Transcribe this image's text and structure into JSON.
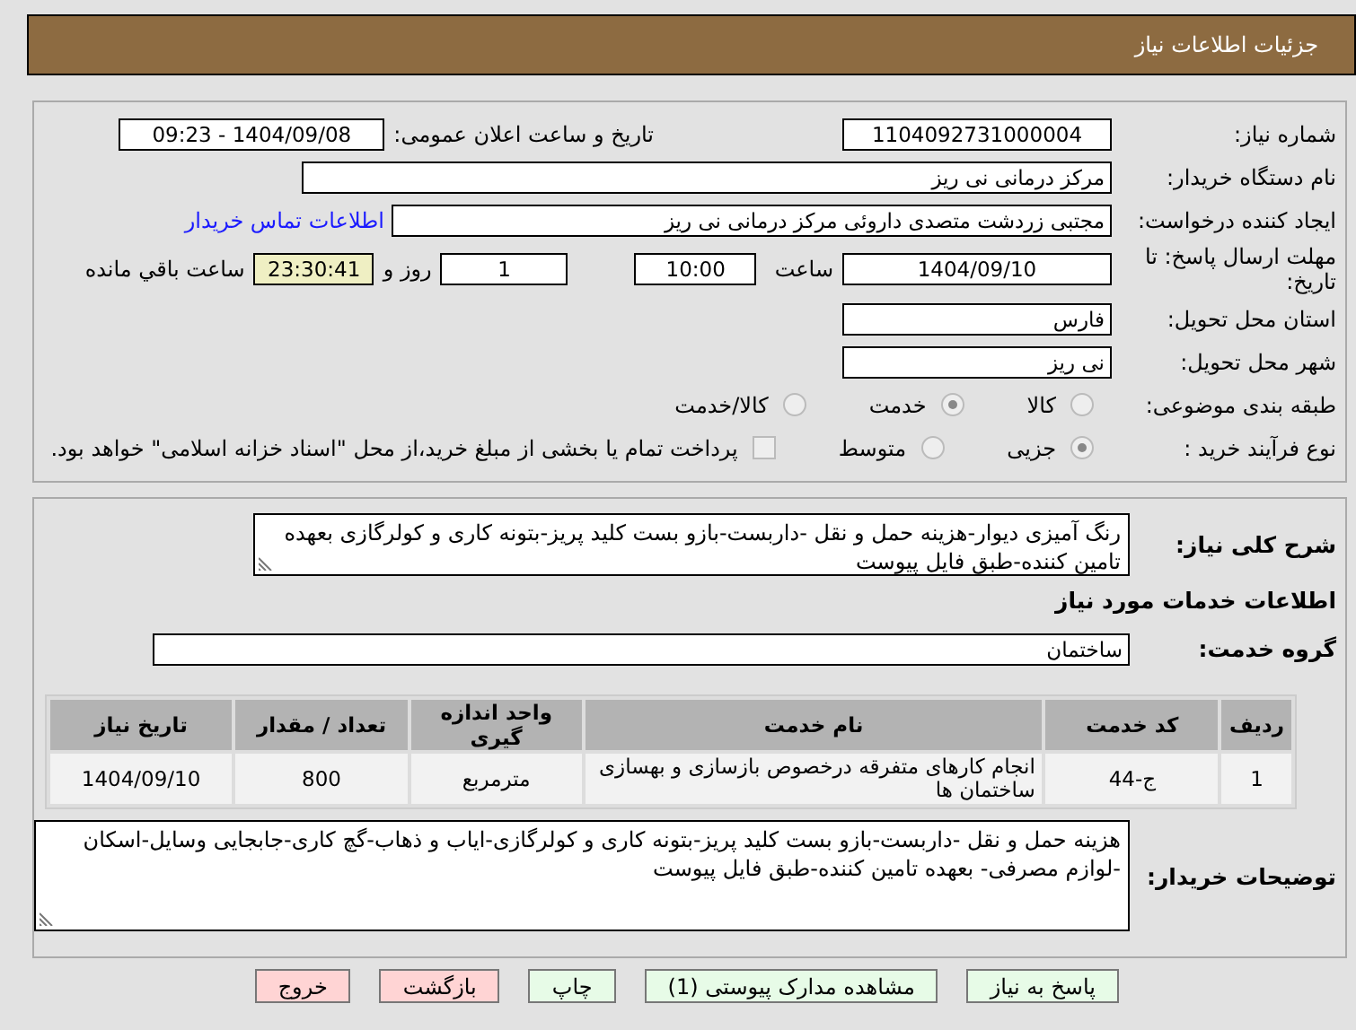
{
  "header": {
    "title": "جزئیات اطلاعات نیاز"
  },
  "need_number": {
    "label": "شماره نیاز:",
    "value": "1104092731000004"
  },
  "announce": {
    "label": "تاریخ و ساعت اعلان عمومی:",
    "value": "1404/09/08 - 09:23"
  },
  "buyer_org": {
    "label": "نام دستگاه خریدار:",
    "value": "مرکز درمانی نی ریز"
  },
  "creator": {
    "label": "ایجاد کننده درخواست:",
    "value": "مجتبی زردشت متصدی داروئی  مرکز درمانی نی ریز",
    "link": "اطلاعات تماس خریدار"
  },
  "deadline": {
    "label": "مهلت ارسال پاسخ: تا تاریخ:",
    "date": "1404/09/10",
    "time_label": "ساعت",
    "time": "10:00",
    "days": "1",
    "days_label": "روز و",
    "remaining": "23:30:41",
    "remaining_label": "ساعت باقي مانده"
  },
  "province": {
    "label": "استان محل تحویل:",
    "value": "فارس"
  },
  "city": {
    "label": "شهر محل تحویل:",
    "value": "نی ریز"
  },
  "category": {
    "label": "طبقه بندی موضوعی:",
    "options": [
      {
        "label": "کالا",
        "selected": false
      },
      {
        "label": "خدمت",
        "selected": true
      },
      {
        "label": "کالا/خدمت",
        "selected": false
      }
    ]
  },
  "purchase_type": {
    "label": "نوع فرآیند خرید :",
    "options": [
      {
        "label": "جزیی",
        "selected": true
      },
      {
        "label": "متوسط",
        "selected": false
      }
    ],
    "payment": {
      "checked": false,
      "text": "پرداخت تمام یا بخشی از مبلغ خرید،از محل \"اسناد خزانه اسلامی\" خواهد بود."
    }
  },
  "description": {
    "label": "شرح کلی نیاز:",
    "value": "رنگ آمیزی دیوار-هزینه حمل و نقل -داربست-بازو بست کلید پریز-بتونه کاری و کولرگازی بعهده تامین کننده-طبق فایل پیوست"
  },
  "services_title": "اطلاعات خدمات مورد نیاز",
  "service_group": {
    "label": "گروه خدمت:",
    "value": "ساختمان"
  },
  "table": {
    "columns": [
      "ردیف",
      "کد خدمت",
      "نام خدمت",
      "واحد اندازه گیری",
      "تعداد / مقدار",
      "تاریخ نیاز"
    ],
    "rows": [
      [
        "1",
        "ج-44",
        "انجام کارهای متفرقه درخصوص بازسازی و بهسازی ساختمان ها",
        "مترمربع",
        "800",
        "1404/09/10"
      ]
    ]
  },
  "notes": {
    "label": "توضیحات خریدار:",
    "value": "هزینه حمل و نقل -داربست-بازو بست کلید پریز-بتونه کاری و کولرگازی-اياب و ذهاب-گچ کاری-جابجایی وسایل-اسکان -لوازم مصرفی- بعهده تامین کننده-طبق فایل پیوست"
  },
  "buttons": [
    {
      "label": "پاسخ به نیاز",
      "kind": "action"
    },
    {
      "label": "مشاهده مدارک پیوستی (1)",
      "kind": "action"
    },
    {
      "label": "چاپ",
      "kind": "action"
    },
    {
      "label": "بازگشت",
      "kind": "exit"
    },
    {
      "label": "خروج",
      "kind": "exit"
    }
  ]
}
